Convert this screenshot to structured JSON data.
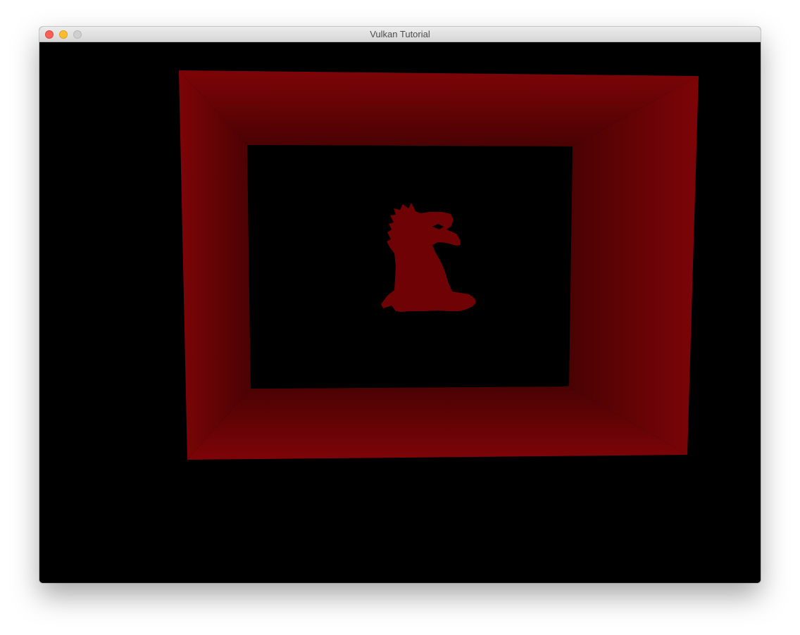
{
  "window": {
    "title": "Vulkan Tutorial"
  },
  "controls": {
    "close": "close-button",
    "minimize": "minimize-button",
    "zoom": "zoom-button"
  },
  "scene": {
    "background_color": "#000000",
    "quad_color": "#7d0407",
    "quad_shadow_color": "#4a0203",
    "model_color": "#6e0205"
  }
}
